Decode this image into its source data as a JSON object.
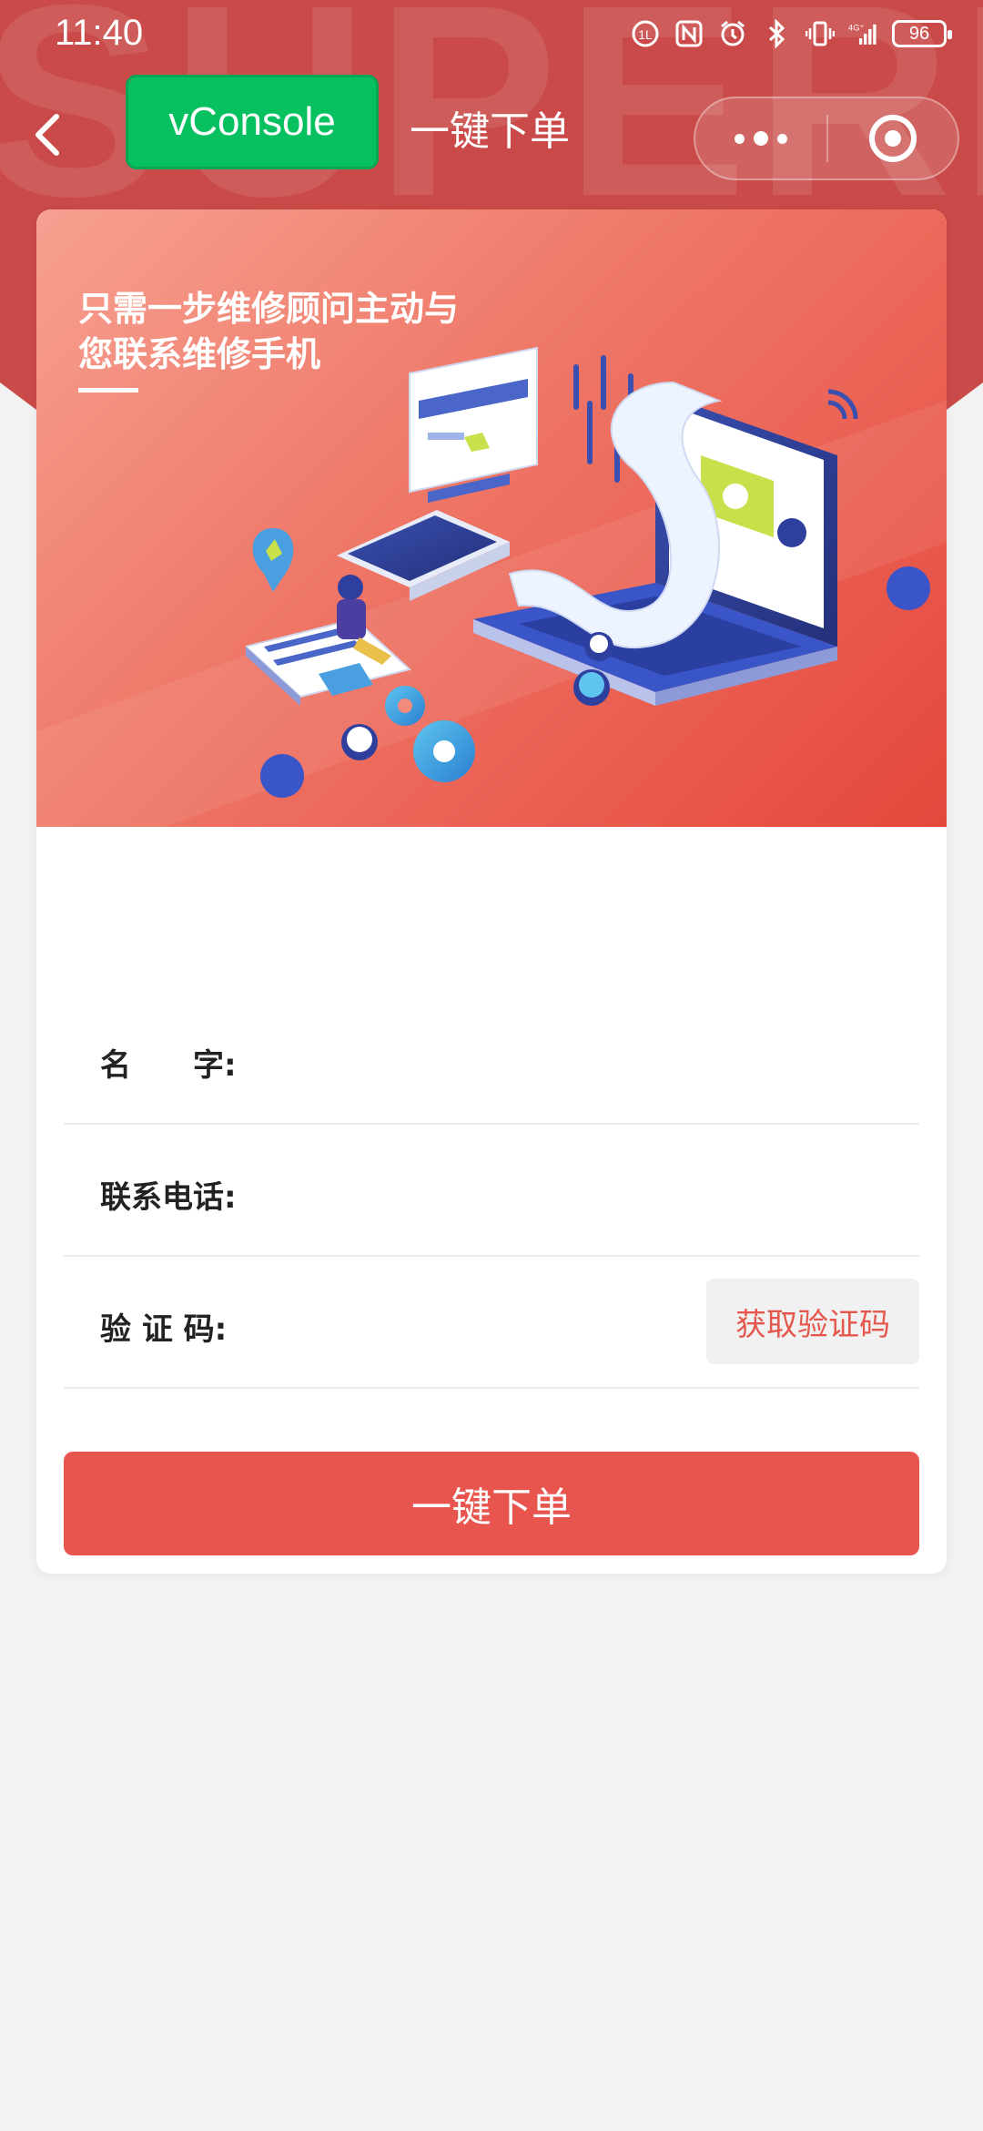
{
  "status_bar": {
    "time": "11:40",
    "battery": "96"
  },
  "header": {
    "watermark": "SUPERMAN FIX",
    "vconsole_label": "vConsole",
    "title": "一键下单"
  },
  "banner": {
    "headline_line1": "只需一步维修顾问主动与",
    "headline_line2": "您联系维修手机"
  },
  "form": {
    "name_label": "名　　字:",
    "phone_label": "联系电话:",
    "code_label": "验  证  码:",
    "get_code_button": "获取验证码"
  },
  "submit_label": "一键下单",
  "colors": {
    "brand_red": "#e8554e",
    "header_red": "#c94a48",
    "vconsole_green": "#07c160"
  },
  "icons": [
    "back-arrow-icon",
    "more-dots-icon",
    "close-circle-icon",
    "data-saver-icon",
    "nfc-icon",
    "alarm-icon",
    "bluetooth-icon",
    "vibrate-icon",
    "signal-icon",
    "battery-icon"
  ]
}
